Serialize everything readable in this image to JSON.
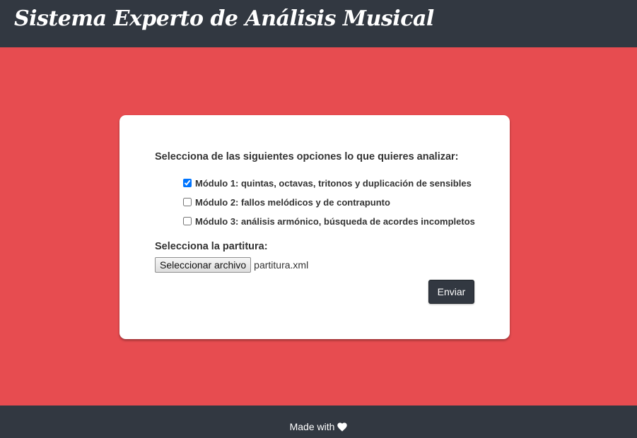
{
  "header": {
    "title": "Sistema Experto de Análisis Musical"
  },
  "form": {
    "question": "Selecciona de las siguientes opciones lo que quieres analizar:",
    "options": [
      {
        "label": "Módulo 1: quintas, octavas, tritonos y duplicación de sensibles",
        "checked": true
      },
      {
        "label": "Módulo 2: fallos melódicos y de contrapunto",
        "checked": false
      },
      {
        "label": "Módulo 3: análisis armónico, búsqueda de acordes incompletos",
        "checked": false
      }
    ],
    "file_label": "Selecciona la partitura:",
    "file_button": "Seleccionar archivo",
    "file_name": "partitura.xml",
    "submit": "Enviar"
  },
  "footer": {
    "text": "Made with",
    "icon": "heart-icon"
  },
  "colors": {
    "accent": "#e74c50",
    "dark": "#323841"
  }
}
